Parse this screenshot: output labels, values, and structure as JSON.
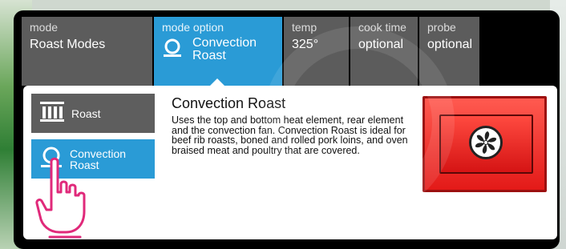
{
  "tabs": {
    "mode": {
      "label": "mode",
      "value": "Roast Modes"
    },
    "mode_option": {
      "label": "mode option",
      "value_line1": "Convection",
      "value_line2": "Roast"
    },
    "temp": {
      "label": "temp",
      "value": "325°"
    },
    "cook_time": {
      "label": "cook time",
      "value": "optional"
    },
    "probe": {
      "label": "probe",
      "value": "optional"
    }
  },
  "options": [
    {
      "label": "Roast",
      "icon": "roast-icon"
    },
    {
      "label_line1": "Convection",
      "label_line2": "Roast",
      "icon": "convection-roast-icon"
    }
  ],
  "detail": {
    "title": "Convection Roast",
    "description": "Uses the top and bottom heat element, rear element and the convection fan. Convection Roast is ideal for beef rib roasts, boned and rolled pork loins, and oven braised meat and poultry that are covered.",
    "image_icon": "convection-fan-icon"
  },
  "colors": {
    "tab_bg": "#5c5c5c",
    "active_blue": "#2a9bd6",
    "oven_red": "#e31a18",
    "hand_pink": "#e0297a"
  }
}
